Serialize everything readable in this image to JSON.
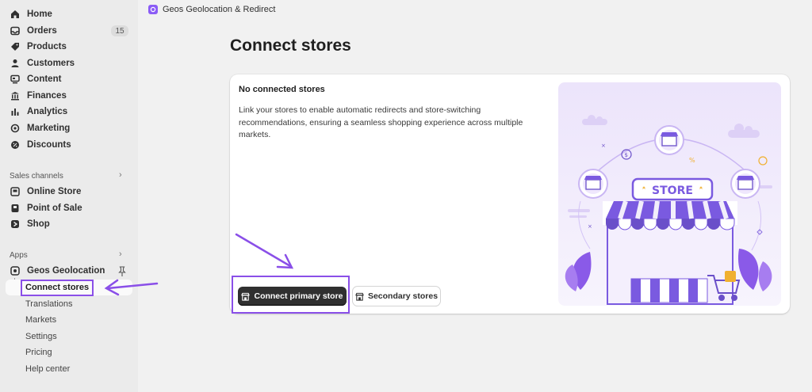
{
  "topbar": {
    "app_title": "Geos Geolocation & Redirect"
  },
  "sidebar": {
    "items": [
      {
        "label": "Home",
        "icon": "home-icon"
      },
      {
        "label": "Orders",
        "icon": "inbox-icon",
        "badge": "15"
      },
      {
        "label": "Products",
        "icon": "tag-icon"
      },
      {
        "label": "Customers",
        "icon": "person-icon"
      },
      {
        "label": "Content",
        "icon": "content-icon"
      },
      {
        "label": "Finances",
        "icon": "bank-icon"
      },
      {
        "label": "Analytics",
        "icon": "bar-chart-icon"
      },
      {
        "label": "Marketing",
        "icon": "target-icon"
      },
      {
        "label": "Discounts",
        "icon": "discount-icon"
      }
    ],
    "sales_channels_label": "Sales channels",
    "sales_channels": [
      {
        "label": "Online Store",
        "icon": "store-icon"
      },
      {
        "label": "Point of Sale",
        "icon": "pos-icon"
      },
      {
        "label": "Shop",
        "icon": "shop-icon"
      }
    ],
    "apps_label": "Apps",
    "app": {
      "label": "Geos Geolocation",
      "icon": "geos-app-icon"
    },
    "app_subitems": [
      "Connect stores",
      "Translations",
      "Markets",
      "Settings",
      "Pricing",
      "Help center"
    ]
  },
  "main": {
    "page_title": "Connect stores",
    "card_title": "No connected stores",
    "card_description": "Link your stores to enable automatic redirects and store-switching recommendations, ensuring a seamless shopping experience across multiple markets.",
    "primary_button": "Connect primary store",
    "secondary_button": "Secondary stores",
    "illustration_sign": "STORE"
  },
  "colors": {
    "accent": "#8a4fe8",
    "primary_button": "#303030",
    "sidebar_bg": "#ebebeb"
  }
}
